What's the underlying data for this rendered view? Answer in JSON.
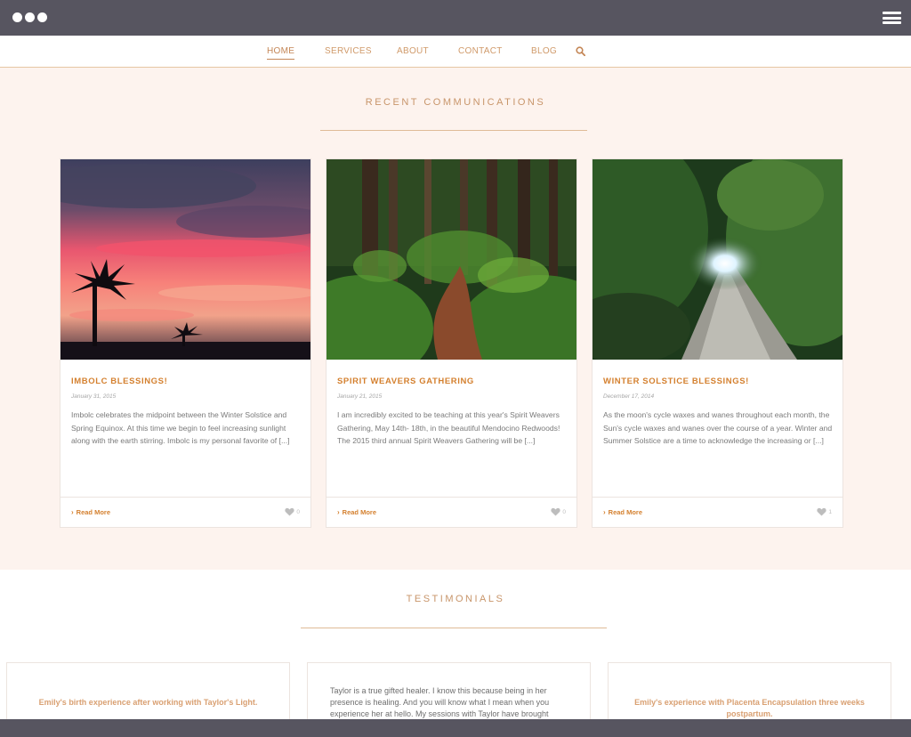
{
  "nav": {
    "items": [
      {
        "label": "HOME",
        "active": true
      },
      {
        "label": "SERVICES",
        "active": false
      },
      {
        "label": "ABOUT",
        "active": false
      },
      {
        "label": "CONTACT",
        "active": false
      },
      {
        "label": "BLOG",
        "active": false
      }
    ],
    "search_icon": "search-icon"
  },
  "recent": {
    "title": "RECENT COMMUNICATIONS",
    "posts": [
      {
        "title": "IMBOLC BLESSINGS!",
        "date": "January 31, 2015",
        "excerpt": "Imbolc celebrates the midpoint between the Winter Solstice and Spring Equinox. At this time we begin to feel increasing sunlight along with the earth stirring. Imbolc is my personal favorite of [...]",
        "read_more": "Read More",
        "likes": "0"
      },
      {
        "title": "SPIRIT WEAVERS GATHERING",
        "date": "January 21, 2015",
        "excerpt": "I am incredibly excited to be teaching at this year's Spirit Weavers Gathering, May 14th- 18th, in the beautiful Mendocino Redwoods! The 2015 third annual Spirit Weavers Gathering will be [...]",
        "read_more": "Read More",
        "likes": "0"
      },
      {
        "title": "WINTER SOLSTICE BLESSINGS!",
        "date": "December 17, 2014",
        "excerpt": "As the moon's cycle waxes and wanes throughout each month, the Sun's cycle waxes and wanes over the course of a year. Winter and Summer Solstice are a time to acknowledge the increasing or [...]",
        "read_more": "Read More",
        "likes": "1"
      }
    ]
  },
  "testimonials": {
    "title": "TESTIMONIALS",
    "items": [
      {
        "link": "Emily's birth experience after working with Taylor's Light."
      },
      {
        "quote": "Taylor is a true gifted healer. I know this because being in her presence is healing. And you will know what I mean when you experience her at hello. My sessions with Taylor have brought"
      },
      {
        "link": "Emily's experience with Placenta Encapsulation three weeks postpartum."
      }
    ]
  },
  "colors": {
    "accent": "#d4802f",
    "nav_text": "#d09a6a",
    "section_bg": "#fdf3ee",
    "frame": "#575560"
  }
}
